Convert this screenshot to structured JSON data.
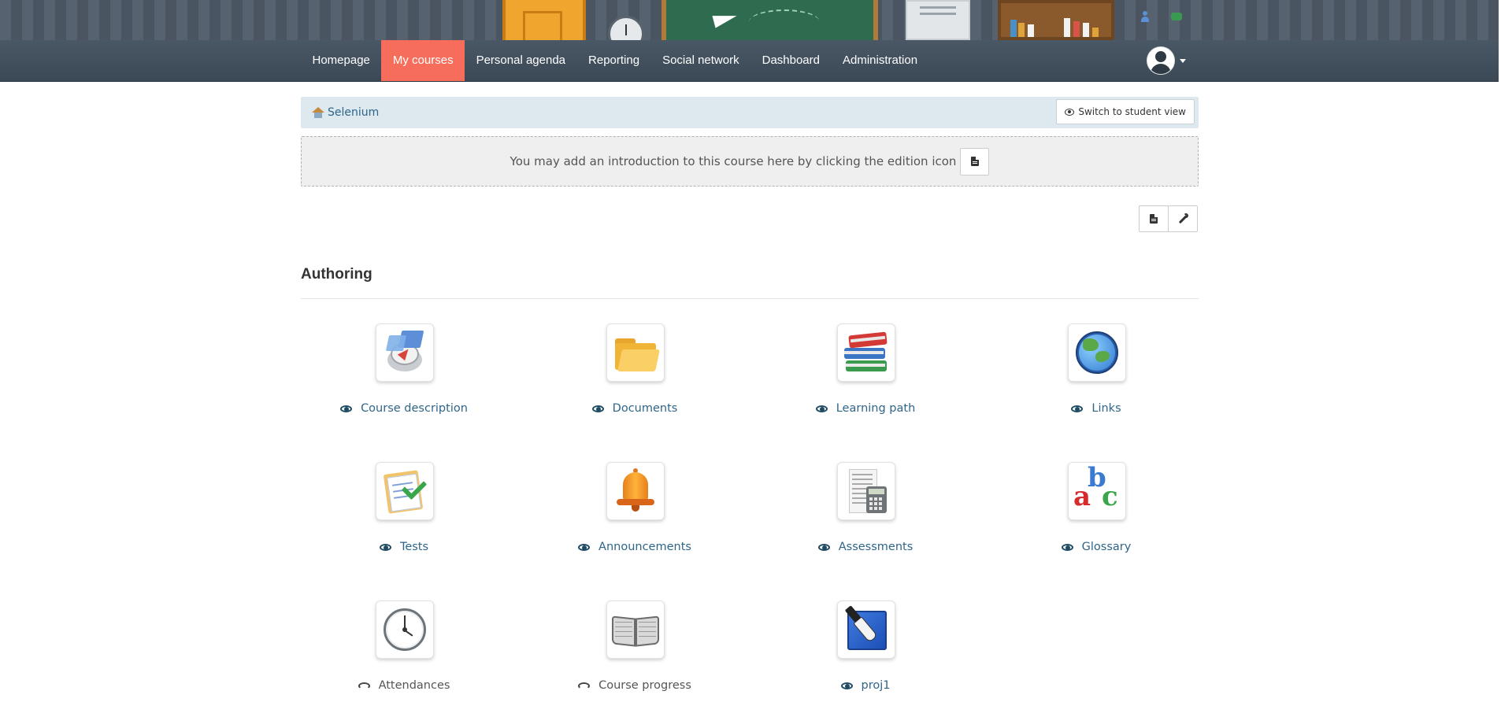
{
  "nav": {
    "items": [
      {
        "label": "Homepage",
        "active": false
      },
      {
        "label": "My courses",
        "active": true
      },
      {
        "label": "Personal agenda",
        "active": false
      },
      {
        "label": "Reporting",
        "active": false
      },
      {
        "label": "Social network",
        "active": false
      },
      {
        "label": "Dashboard",
        "active": false
      },
      {
        "label": "Administration",
        "active": false
      }
    ],
    "active_color": "#f66e5b"
  },
  "breadcrumb": {
    "course": "Selenium",
    "student_view_label": "Switch to student view"
  },
  "intro": {
    "text": "You may add an introduction to this course here by clicking the edition icon"
  },
  "section": {
    "title": "Authoring"
  },
  "tools": [
    {
      "label": "Course description",
      "icon": "compass-icon",
      "visible": true
    },
    {
      "label": "Documents",
      "icon": "folder-icon",
      "visible": true
    },
    {
      "label": "Learning path",
      "icon": "books-icon",
      "visible": true
    },
    {
      "label": "Links",
      "icon": "globe-icon",
      "visible": true
    },
    {
      "label": "Tests",
      "icon": "checklist-icon",
      "visible": true
    },
    {
      "label": "Announcements",
      "icon": "bell-icon",
      "visible": true
    },
    {
      "label": "Assessments",
      "icon": "calculator-icon",
      "visible": true
    },
    {
      "label": "Glossary",
      "icon": "abc-icon",
      "visible": true
    },
    {
      "label": "Attendances",
      "icon": "clock-icon",
      "visible": false
    },
    {
      "label": "Course progress",
      "icon": "open-book-icon",
      "visible": false
    },
    {
      "label": "proj1",
      "icon": "pen-icon",
      "visible": true
    }
  ]
}
